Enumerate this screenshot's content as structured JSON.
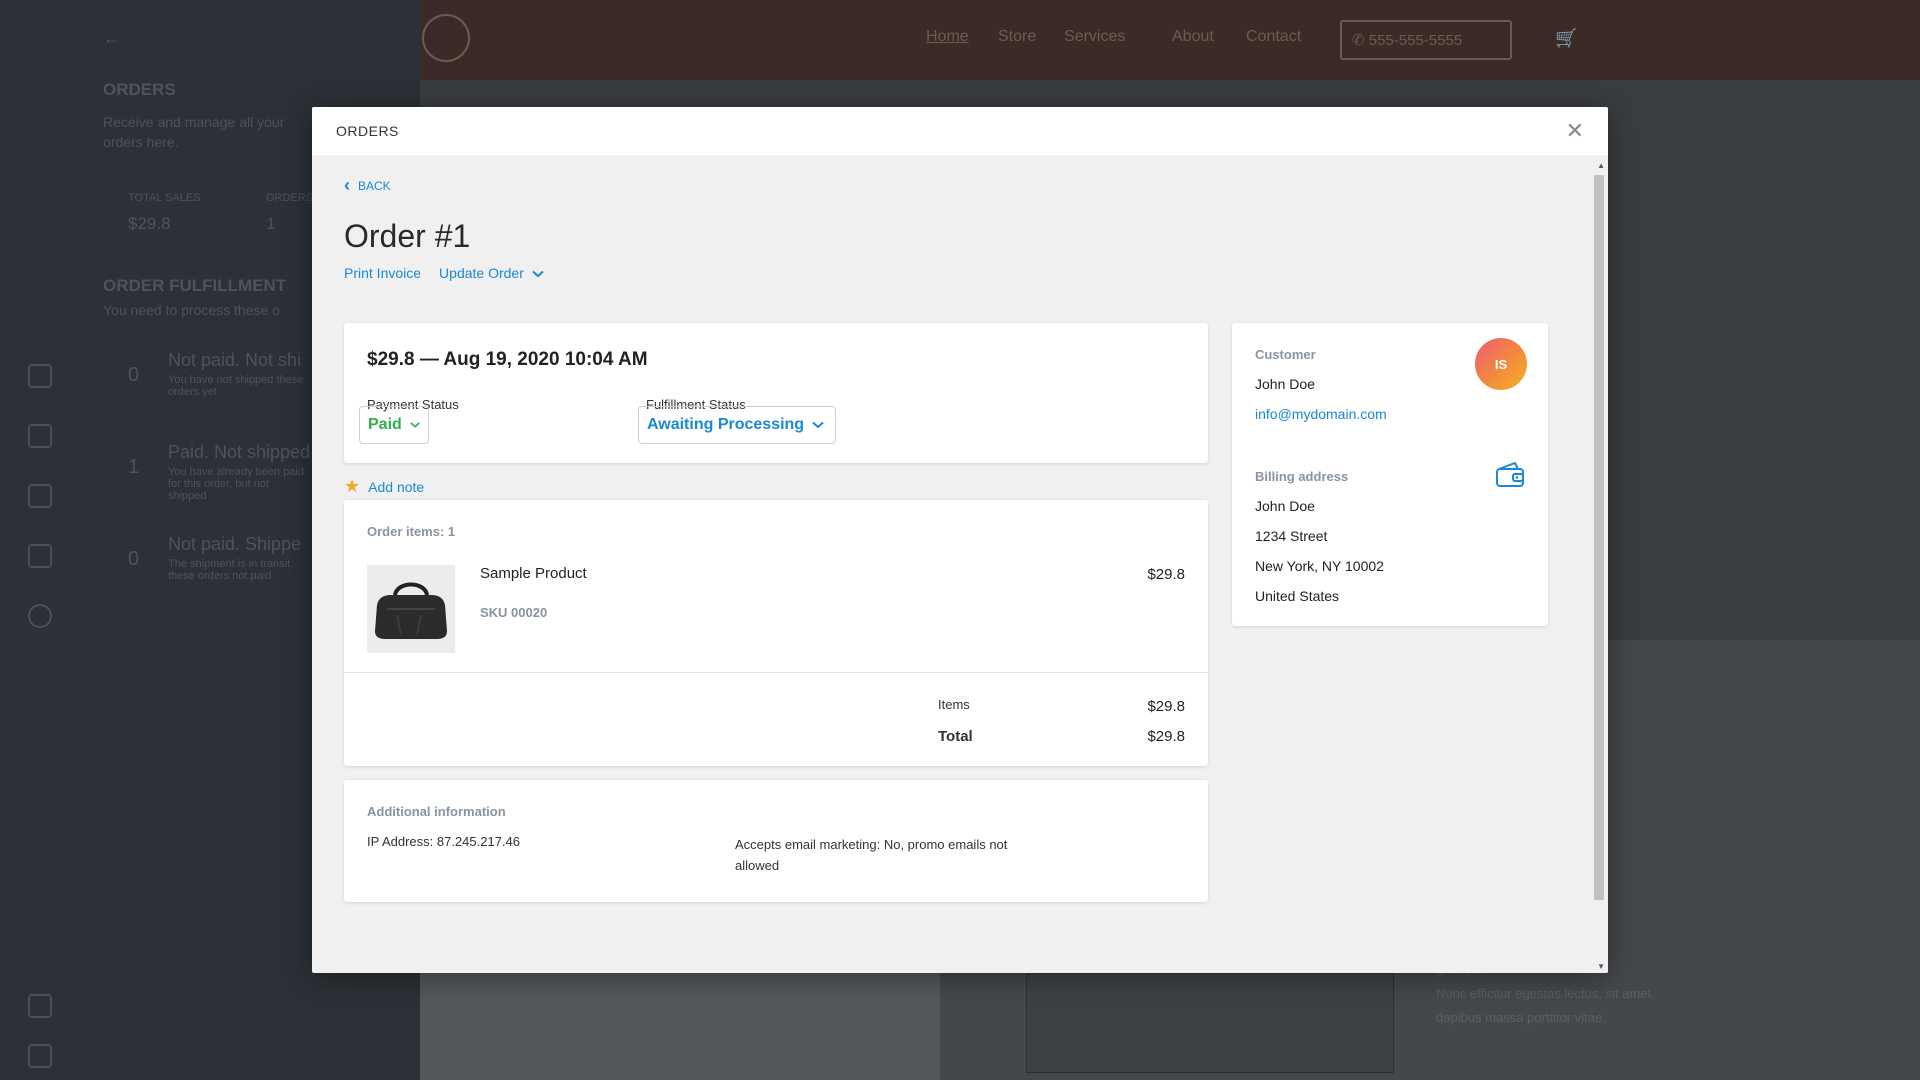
{
  "modal": {
    "title": "ORDERS",
    "close_icon": "close-icon"
  },
  "nav": {
    "back_label": "BACK"
  },
  "order": {
    "title": "Order  #1",
    "actions": {
      "print_invoice": "Print Invoice",
      "update_order": "Update Order"
    },
    "summary": {
      "headline": "$29.8 — Aug 19, 2020 10:04 AM",
      "payment_status_label": "Payment Status",
      "payment_status_value": "Paid",
      "fulfillment_status_label": "Fulfillment Status",
      "fulfillment_status_value": "Awaiting Processing"
    },
    "add_note": "Add note",
    "items": {
      "count_label": "Order items: 1",
      "list": [
        {
          "name": "Sample Product",
          "sku": "SKU  00020",
          "price": "$29.8"
        }
      ],
      "items_label": "Items",
      "items_total": "$29.8",
      "total_label": "Total",
      "total_value": "$29.8"
    },
    "additional": {
      "title": "Additional information",
      "ip": "IP Address: 87.245.217.46",
      "marketing": "Accepts email marketing: No, promo emails not allowed"
    },
    "customer": {
      "label": "Customer",
      "name": "John Doe",
      "email": "info@mydomain.com",
      "avatar_initials": "IS",
      "billing_label": "Billing address",
      "billing_lines": [
        "John Doe",
        "1234 Street",
        "New York, NY 10002",
        "United States"
      ]
    }
  },
  "background": {
    "nav_items": [
      "Home",
      "Store",
      "Services",
      "About",
      "Contact"
    ],
    "phone": "555-555-5555",
    "left_title": "ORDERS",
    "left_subtitle": "Receive and manage all your orders here.",
    "total_sales_label": "TOTAL SALES",
    "total_sales_value": "$29.8",
    "orders_label": "ORDERS",
    "orders_value": "1",
    "fulfillment_title": "ORDER FULFILLMENT",
    "fulfillment_subtitle": "You need to process these o",
    "groups": [
      {
        "count": "0",
        "title": "Not paid. Not shi",
        "desc": "You have not shipped these orders yet"
      },
      {
        "count": "1",
        "title": "Paid. Not shipped",
        "desc": "You have already been paid for this order, but not shipped"
      },
      {
        "count": "0",
        "title": "Not paid. Shippe",
        "desc": "The shipment is in transit, these orders not paid"
      }
    ],
    "footer_text": [
      "gravida.",
      "Nunc efficitur egestas lectus, sit amet",
      "dapibus massa porttitor vitae."
    ]
  },
  "colors": {
    "accent": "#1a88d8",
    "paid": "#2bb24c",
    "star": "#f5a623"
  }
}
